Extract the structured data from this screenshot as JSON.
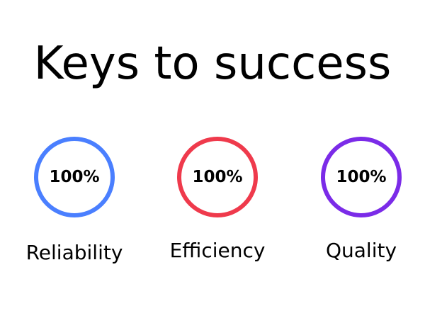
{
  "title": "Keys to success",
  "items": [
    {
      "label": "Reliability",
      "value": "100%",
      "percent": 100,
      "color": "#4a7fff"
    },
    {
      "label": "Efficiency",
      "value": "100%",
      "percent": 100,
      "color": "#ef3a4c"
    },
    {
      "label": "Quality",
      "value": "100%",
      "percent": 100,
      "color": "#7b2be8"
    }
  ]
}
